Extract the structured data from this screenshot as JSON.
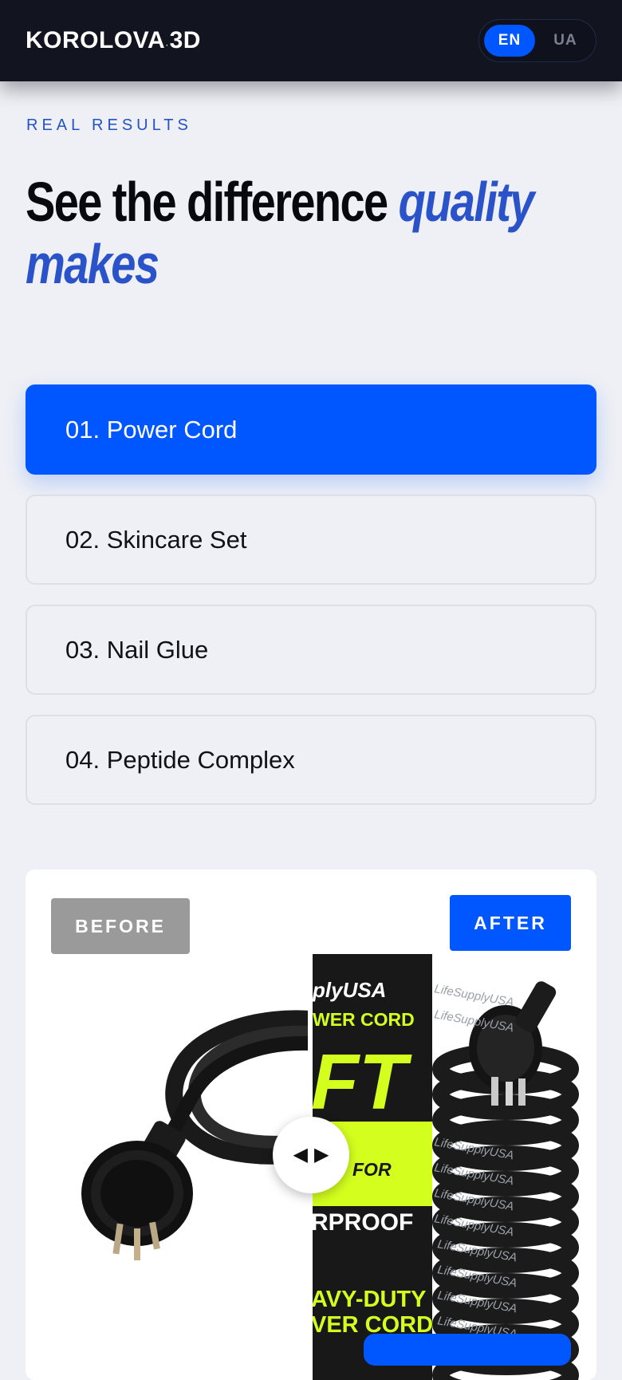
{
  "header": {
    "logo_main": "KOROLOVA",
    "logo_dot": "·",
    "logo_suffix": "3D",
    "languages": [
      {
        "label": "EN",
        "active": true
      },
      {
        "label": "UA",
        "active": false
      }
    ]
  },
  "hero": {
    "eyebrow": "REAL RESULTS",
    "headline_plain": "See the difference",
    "headline_accent_1": "quality",
    "headline_accent_2": "makes"
  },
  "tabs": [
    {
      "label": "01. Power Cord",
      "active": true
    },
    {
      "label": "02. Skincare Set",
      "active": false
    },
    {
      "label": "03. Nail Glue",
      "active": false
    },
    {
      "label": "04. Peptide Complex",
      "active": false
    }
  ],
  "comparison": {
    "before_label": "BEFORE",
    "after_label": "AFTER",
    "handle_left": "◀",
    "handle_right": "▶",
    "packaging_text": {
      "brand": "plyUSA",
      "line1": "WER CORD",
      "line2": "FT",
      "line3": "FOR",
      "line4": "RPROOF",
      "line5": "AVY-DUTY",
      "line6": "VER CORD"
    },
    "cord_print": "LifeSupplyUSA"
  },
  "colors": {
    "accent": "#0057ff",
    "header_bg": "#121420",
    "page_bg": "#eef0f5",
    "eyebrow": "#2452c4",
    "neon": "#d4ff1e"
  },
  "icons": [
    "arrow-left-icon",
    "arrow-right-icon"
  ]
}
